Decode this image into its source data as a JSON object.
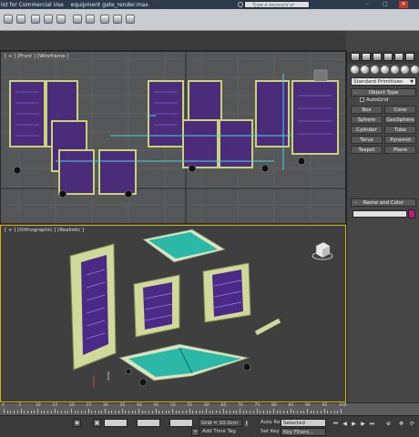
{
  "titlebar": {
    "app_title": "lot for Commercial Use",
    "filename": "equipment gate_render.max",
    "search_placeholder": "Type a keyword or phrase",
    "minimize": "–",
    "maximize": "□",
    "close": "✕"
  },
  "viewports": {
    "front_label": "[ + ] [Front ] [Wireframe ]",
    "persp_label": "[ + ] [Orthographic ] [Realistic ]"
  },
  "command_panel": {
    "primitive_type": "Standard Primitives",
    "object_type_title": "Object Type",
    "autogrid_label": "AutoGrid",
    "object_buttons": [
      "Box",
      "Cone",
      "Sphere",
      "GeoSphere",
      "Cylinder",
      "Tube",
      "Torus",
      "Pyramid",
      "Teapot",
      "Plane"
    ],
    "name_color_title": "Name and Color",
    "swatch_color": "#c2187a"
  },
  "timeline": {
    "frame_labels": [
      "0",
      "5",
      "10",
      "15",
      "20",
      "25",
      "30",
      "35",
      "40",
      "45",
      "50",
      "55",
      "60",
      "65",
      "70",
      "75",
      "80",
      "85",
      "90",
      "95",
      "100"
    ]
  },
  "status_bar": {
    "grid_text": "Grid = 10.0cm",
    "add_time_tag": "Add Time Tag",
    "auto_key": "Auto Key",
    "set_key": "Set Key",
    "selected_value": "Selected",
    "key_filters": "Key Filters..."
  },
  "colors": {
    "gate_frame": "#c9d47a",
    "gate_panel": "#5a2d8a",
    "cart_top": "#2bb8a6",
    "wire_cyan": "#4fd1e6",
    "active_border": "#d4b400"
  }
}
